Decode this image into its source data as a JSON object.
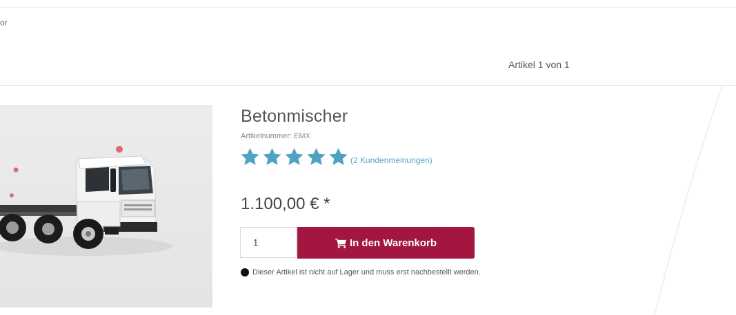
{
  "breadcrumb": {
    "fragment": "or"
  },
  "pager": {
    "text": "Artikel 1 von 1"
  },
  "product": {
    "title": "Betonmischer",
    "article_number": "Artikelnummer: EMX",
    "rating": {
      "stars": 5,
      "max": 5
    },
    "reviews_link": "(2 Kundenmeinungen)",
    "price": "1.100,00 € *",
    "quantity": "1",
    "cart_button": "In den Warenkorb",
    "stock_note": "Dieser Artikel ist nicht auf Lager und muss erst nachbestellt werden."
  },
  "colors": {
    "accent": "#a3163f",
    "star": "#4ea2c4",
    "link": "#5aa3c6"
  },
  "icons": {
    "cart": "cart-icon",
    "star": "star-icon",
    "stock": "stock-status-dot"
  }
}
